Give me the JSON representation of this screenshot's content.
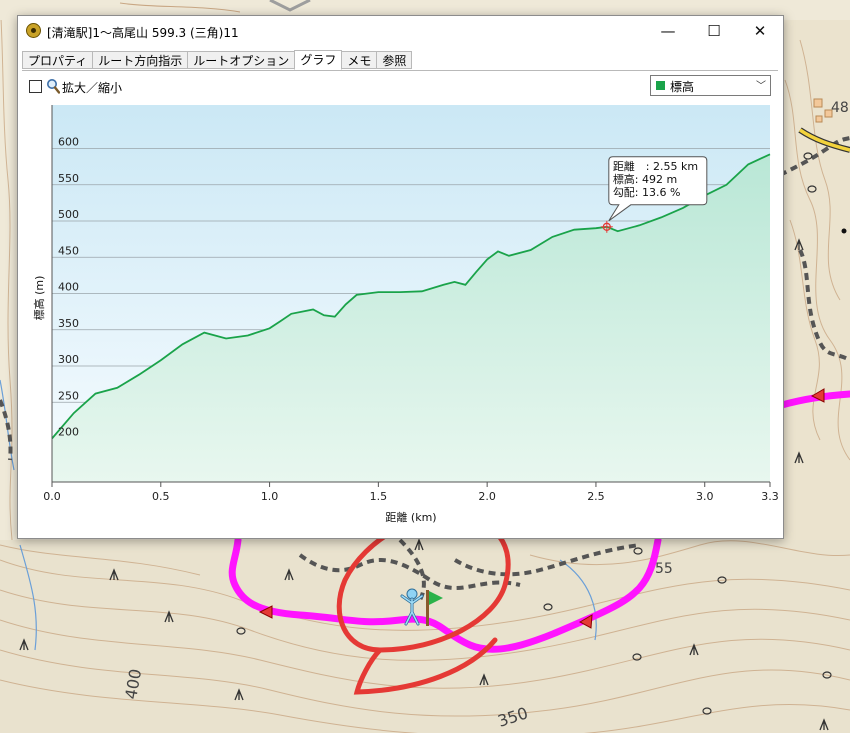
{
  "window": {
    "title": "[清滝駅]1～高尾山 599.3 (三角)11",
    "minimize_glyph": "—",
    "maximize_glyph": "☐",
    "close_glyph": "✕",
    "tabs": [
      "プロパティ",
      "ルート方向指示",
      "ルートオプション",
      "グラフ",
      "メモ",
      "参照"
    ],
    "active_tab": "グラフ"
  },
  "toolbar": {
    "zoom_label": "拡大／縮小",
    "zoom_checked": false,
    "series_selected": "標高",
    "series_color": "#1aa34a"
  },
  "tooltip": {
    "line1": "距離　: 2.55 km",
    "line2": "標高: 492 m",
    "line3": "勾配: 13.6 %"
  },
  "map_labels": {
    "contour_400": "400",
    "contour_350": "350",
    "contour_55": "55",
    "contour_48": "48"
  },
  "chart_data": {
    "type": "area",
    "xlabel": "距離 (km)",
    "ylabel": "標高 (m)",
    "xlim": [
      0,
      3.3
    ],
    "ylim": [
      140,
      660
    ],
    "x_ticks": [
      "0.0",
      "0.5",
      "1.0",
      "1.5",
      "2.0",
      "2.5",
      "3.0",
      "3.3"
    ],
    "x_tick_values": [
      0.0,
      0.5,
      1.0,
      1.5,
      2.0,
      2.5,
      3.0,
      3.3
    ],
    "y_ticks": [
      "200",
      "250",
      "300",
      "350",
      "400",
      "450",
      "500",
      "550",
      "600"
    ],
    "y_tick_values": [
      200,
      250,
      300,
      350,
      400,
      450,
      500,
      550,
      600
    ],
    "grid": true,
    "line_color": "#1aa34a",
    "series": [
      {
        "x": [
          0.0,
          0.1,
          0.2,
          0.3,
          0.4,
          0.5,
          0.6,
          0.7,
          0.8,
          0.9,
          1.0,
          1.05,
          1.1,
          1.2,
          1.25,
          1.3,
          1.35,
          1.4,
          1.45,
          1.5,
          1.6,
          1.7,
          1.8,
          1.85,
          1.9,
          1.95,
          2.0,
          2.05,
          2.1,
          2.2,
          2.3,
          2.4,
          2.5,
          2.55,
          2.6,
          2.7,
          2.8,
          2.9,
          3.0,
          3.1,
          3.2,
          3.3
        ],
        "y": [
          200,
          235,
          262,
          270,
          288,
          308,
          330,
          346,
          338,
          342,
          352,
          362,
          372,
          378,
          370,
          368,
          385,
          398,
          400,
          402,
          402,
          403,
          412,
          416,
          412,
          430,
          447,
          458,
          452,
          460,
          478,
          488,
          490,
          492,
          486,
          494,
          505,
          518,
          535,
          550,
          578,
          592
        ]
      }
    ],
    "highlight": {
      "x": 2.55,
      "y": 492
    }
  }
}
